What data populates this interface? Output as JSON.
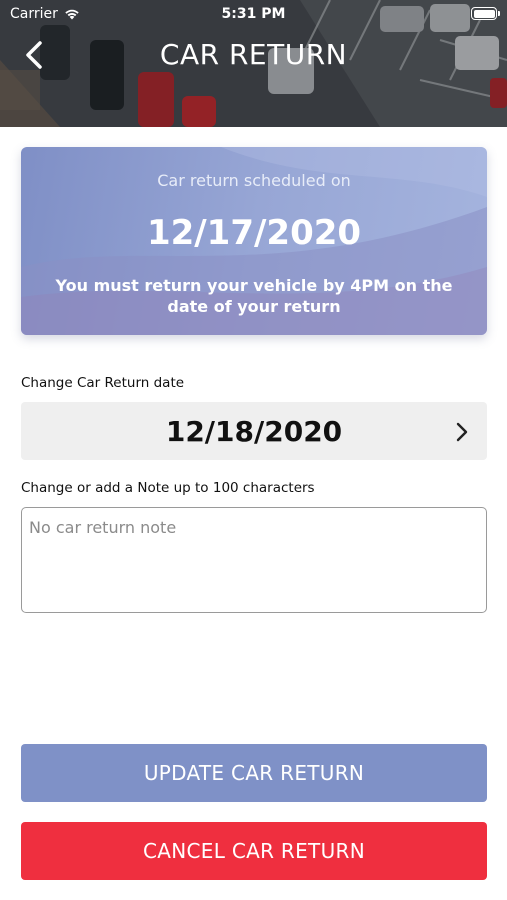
{
  "status_bar": {
    "carrier": "Carrier",
    "time": "5:31 PM"
  },
  "header": {
    "title": "CAR RETURN",
    "back_icon": "chevron-left-icon"
  },
  "schedule_card": {
    "caption": "Car return scheduled on",
    "date": "12/17/2020",
    "notice": "You must return your vehicle by 4PM on the date of your return"
  },
  "change_date": {
    "label": "Change Car Return date",
    "value": "12/18/2020",
    "icon": "chevron-right-icon"
  },
  "note": {
    "label": "Change or add a Note up to 100 characters",
    "placeholder": "No car return note",
    "value": ""
  },
  "actions": {
    "update_label": "UPDATE CAR RETURN",
    "cancel_label": "CANCEL CAR RETURN"
  },
  "colors": {
    "accent": "#7f91c7",
    "danger": "#ef2f3f",
    "card": "#97a6d5"
  }
}
